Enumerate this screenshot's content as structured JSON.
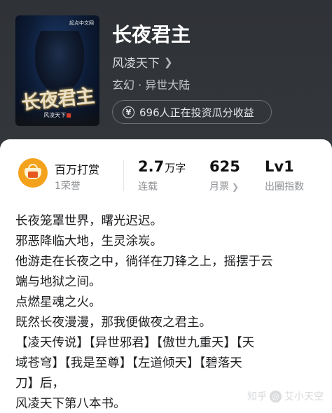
{
  "book": {
    "title": "长夜君主",
    "author": "风凌天下",
    "genre": "玄幻 · 异世大陆",
    "invest_text": "696人正在投资瓜分收益",
    "cover": {
      "publisher": "起点中文网",
      "title": "长夜君主",
      "author": "风凌天下"
    }
  },
  "stats": {
    "reward_label": "百万打赏",
    "reward_sub": "1荣誉",
    "words_value": "2.7",
    "words_unit": "万字",
    "words_sub": "连载",
    "tickets_value": "625",
    "tickets_sub": "月票",
    "level_value": "Lv1",
    "level_sub": "出圈指数"
  },
  "description": [
    "长夜笼罩世界，曙光迟迟。",
    "邪恶降临大地，生灵涂炭。",
    "他游走在长夜之中，徜徉在刀锋之上，摇摆于云",
    "端与地狱之间。",
    "点燃星魂之火。",
    "既然长夜漫漫，那我便做夜之君主。",
    "【凌天传说】【异世邪君】【傲世九重天】【天",
    "域苍穹】【我是至尊】【左道倾天】【碧落天",
    "刀】后，",
    "风凌天下第八本书。"
  ],
  "watermark": {
    "site": "知乎",
    "user": "艾小天空"
  }
}
